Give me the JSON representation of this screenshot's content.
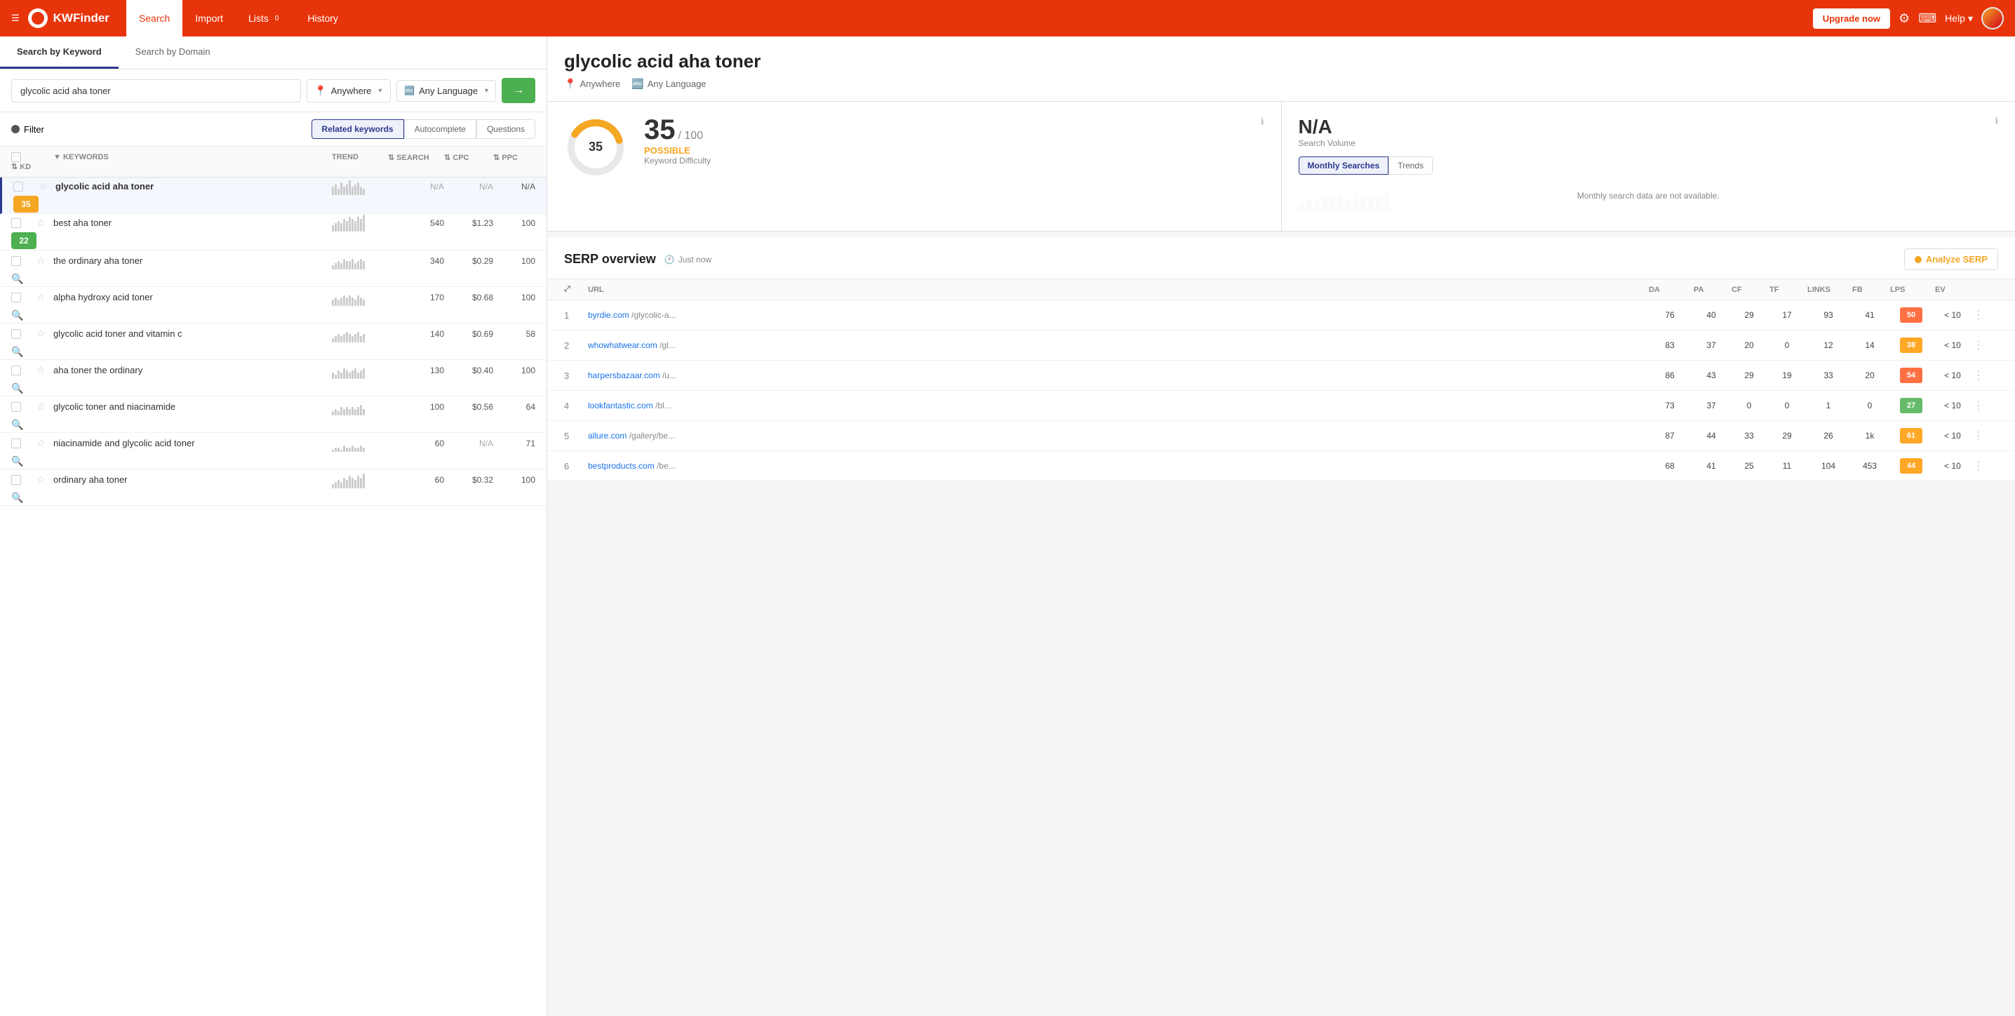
{
  "nav": {
    "brand": "KWFinder",
    "tabs": [
      {
        "label": "Search",
        "active": true
      },
      {
        "label": "Import",
        "active": false
      },
      {
        "label": "Lists",
        "badge": "0",
        "active": false
      },
      {
        "label": "History",
        "active": false
      }
    ],
    "upgrade_label": "Upgrade now",
    "help_label": "Help"
  },
  "left": {
    "search_tabs": [
      {
        "label": "Search by Keyword",
        "active": true
      },
      {
        "label": "Search by Domain",
        "active": false
      }
    ],
    "search_input": "glycolic acid aha toner",
    "location": "Anywhere",
    "language": "Any Language",
    "search_btn": "→",
    "filter_label": "Filter",
    "kw_type_tabs": [
      {
        "label": "Related keywords",
        "active": true
      },
      {
        "label": "Autocomplete",
        "active": false
      },
      {
        "label": "Questions",
        "active": false
      }
    ],
    "table_headers": [
      "",
      "",
      "Keywords",
      "Trend",
      "Search",
      "CPC",
      "PPC",
      "KD"
    ],
    "keywords": [
      {
        "name": "glycolic acid aha toner",
        "search": "N/A",
        "cpc": "N/A",
        "ppc": "N/A",
        "kd": "35",
        "kd_class": "kd-35",
        "selected": true,
        "trend_heights": [
          4,
          5,
          3,
          6,
          4,
          5,
          7,
          4,
          5,
          6,
          4,
          3
        ]
      },
      {
        "name": "best aha toner",
        "search": "540",
        "cpc": "$1.23",
        "ppc": "100",
        "kd": "22",
        "kd_class": "kd-22",
        "selected": false,
        "trend_heights": [
          3,
          4,
          5,
          4,
          6,
          5,
          7,
          6,
          5,
          7,
          6,
          8
        ]
      },
      {
        "name": "the ordinary aha toner",
        "search": "340",
        "cpc": "$0.29",
        "ppc": "100",
        "kd": "",
        "kd_class": "",
        "selected": false,
        "trend_heights": [
          2,
          3,
          4,
          3,
          5,
          4,
          4,
          5,
          3,
          4,
          5,
          4
        ]
      },
      {
        "name": "alpha hydroxy acid toner",
        "search": "170",
        "cpc": "$0.68",
        "ppc": "100",
        "kd": "",
        "kd_class": "",
        "selected": false,
        "trend_heights": [
          3,
          4,
          3,
          4,
          5,
          4,
          5,
          4,
          3,
          5,
          4,
          3
        ]
      },
      {
        "name": "glycolic acid toner and vitamin c",
        "search": "140",
        "cpc": "$0.69",
        "ppc": "58",
        "kd": "",
        "kd_class": "",
        "selected": false,
        "trend_heights": [
          2,
          3,
          4,
          3,
          4,
          5,
          4,
          3,
          4,
          5,
          3,
          4
        ]
      },
      {
        "name": "aha toner the ordinary",
        "search": "130",
        "cpc": "$0.40",
        "ppc": "100",
        "kd": "",
        "kd_class": "",
        "selected": false,
        "trend_heights": [
          3,
          2,
          4,
          3,
          5,
          4,
          3,
          4,
          5,
          3,
          4,
          5
        ]
      },
      {
        "name": "glycolic toner and niacinamide",
        "search": "100",
        "cpc": "$0.56",
        "ppc": "64",
        "kd": "",
        "kd_class": "",
        "selected": false,
        "trend_heights": [
          2,
          3,
          2,
          4,
          3,
          4,
          3,
          4,
          3,
          4,
          5,
          3
        ]
      },
      {
        "name": "niacinamide and glycolic acid toner",
        "search": "60",
        "cpc": "N/A",
        "ppc": "71",
        "kd": "",
        "kd_class": "",
        "selected": false,
        "trend_heights": [
          1,
          2,
          2,
          1,
          3,
          2,
          2,
          3,
          2,
          2,
          3,
          2
        ]
      },
      {
        "name": "ordinary aha toner",
        "search": "60",
        "cpc": "$0.32",
        "ppc": "100",
        "kd": "",
        "kd_class": "",
        "selected": false,
        "trend_heights": [
          2,
          3,
          4,
          3,
          5,
          4,
          6,
          5,
          4,
          6,
          5,
          7
        ]
      }
    ]
  },
  "right": {
    "title": "glycolic acid aha toner",
    "location": "Anywhere",
    "language": "Any Language",
    "kd_number": "35",
    "kd_denom": "/ 100",
    "kd_label": "POSSIBLE",
    "kd_sublabel": "Keyword Difficulty",
    "sv_value": "N/A",
    "sv_sublabel": "Search Volume",
    "sv_tabs": [
      {
        "label": "Monthly Searches",
        "active": true
      },
      {
        "label": "Trends",
        "active": false
      }
    ],
    "sv_chart_note": "Monthly search data are not available.",
    "serp_title": "SERP overview",
    "serp_time": "Just now",
    "analyze_btn": "Analyze SERP",
    "serp_headers": [
      "",
      "URL",
      "DA",
      "PA",
      "CF",
      "TF",
      "Links",
      "FB",
      "LPS",
      "EV",
      ""
    ],
    "serp_rows": [
      {
        "rank": "1",
        "domain": "byrdie.com",
        "path": "/glycolic-a...",
        "da": "76",
        "pa": "40",
        "cf": "29",
        "tf": "17",
        "links": "93",
        "fb": "41",
        "lps": "50",
        "lps_class": "lps-50",
        "ev": "< 10"
      },
      {
        "rank": "2",
        "domain": "whowhatwear.com",
        "path": "/gl...",
        "da": "83",
        "pa": "37",
        "cf": "20",
        "tf": "0",
        "links": "12",
        "fb": "14",
        "lps": "38",
        "lps_class": "lps-38",
        "ev": "< 10"
      },
      {
        "rank": "3",
        "domain": "harpersbazaar.com",
        "path": "/u...",
        "da": "86",
        "pa": "43",
        "cf": "29",
        "tf": "19",
        "links": "33",
        "fb": "20",
        "lps": "54",
        "lps_class": "lps-54",
        "ev": "< 10"
      },
      {
        "rank": "4",
        "domain": "lookfantastic.com",
        "path": "/bl...",
        "da": "73",
        "pa": "37",
        "cf": "0",
        "tf": "0",
        "links": "1",
        "fb": "0",
        "lps": "27",
        "lps_class": "lps-27",
        "ev": "< 10"
      },
      {
        "rank": "5",
        "domain": "allure.com",
        "path": "/gallery/be...",
        "da": "87",
        "pa": "44",
        "cf": "33",
        "tf": "29",
        "links": "26",
        "fb": "1k",
        "lps": "61",
        "lps_class": "lps-61",
        "ev": "< 10"
      },
      {
        "rank": "6",
        "domain": "bestproducts.com",
        "path": "/be...",
        "da": "68",
        "pa": "41",
        "cf": "25",
        "tf": "11",
        "links": "104",
        "fb": "453",
        "lps": "44",
        "lps_class": "lps-44",
        "ev": "< 10"
      }
    ]
  }
}
